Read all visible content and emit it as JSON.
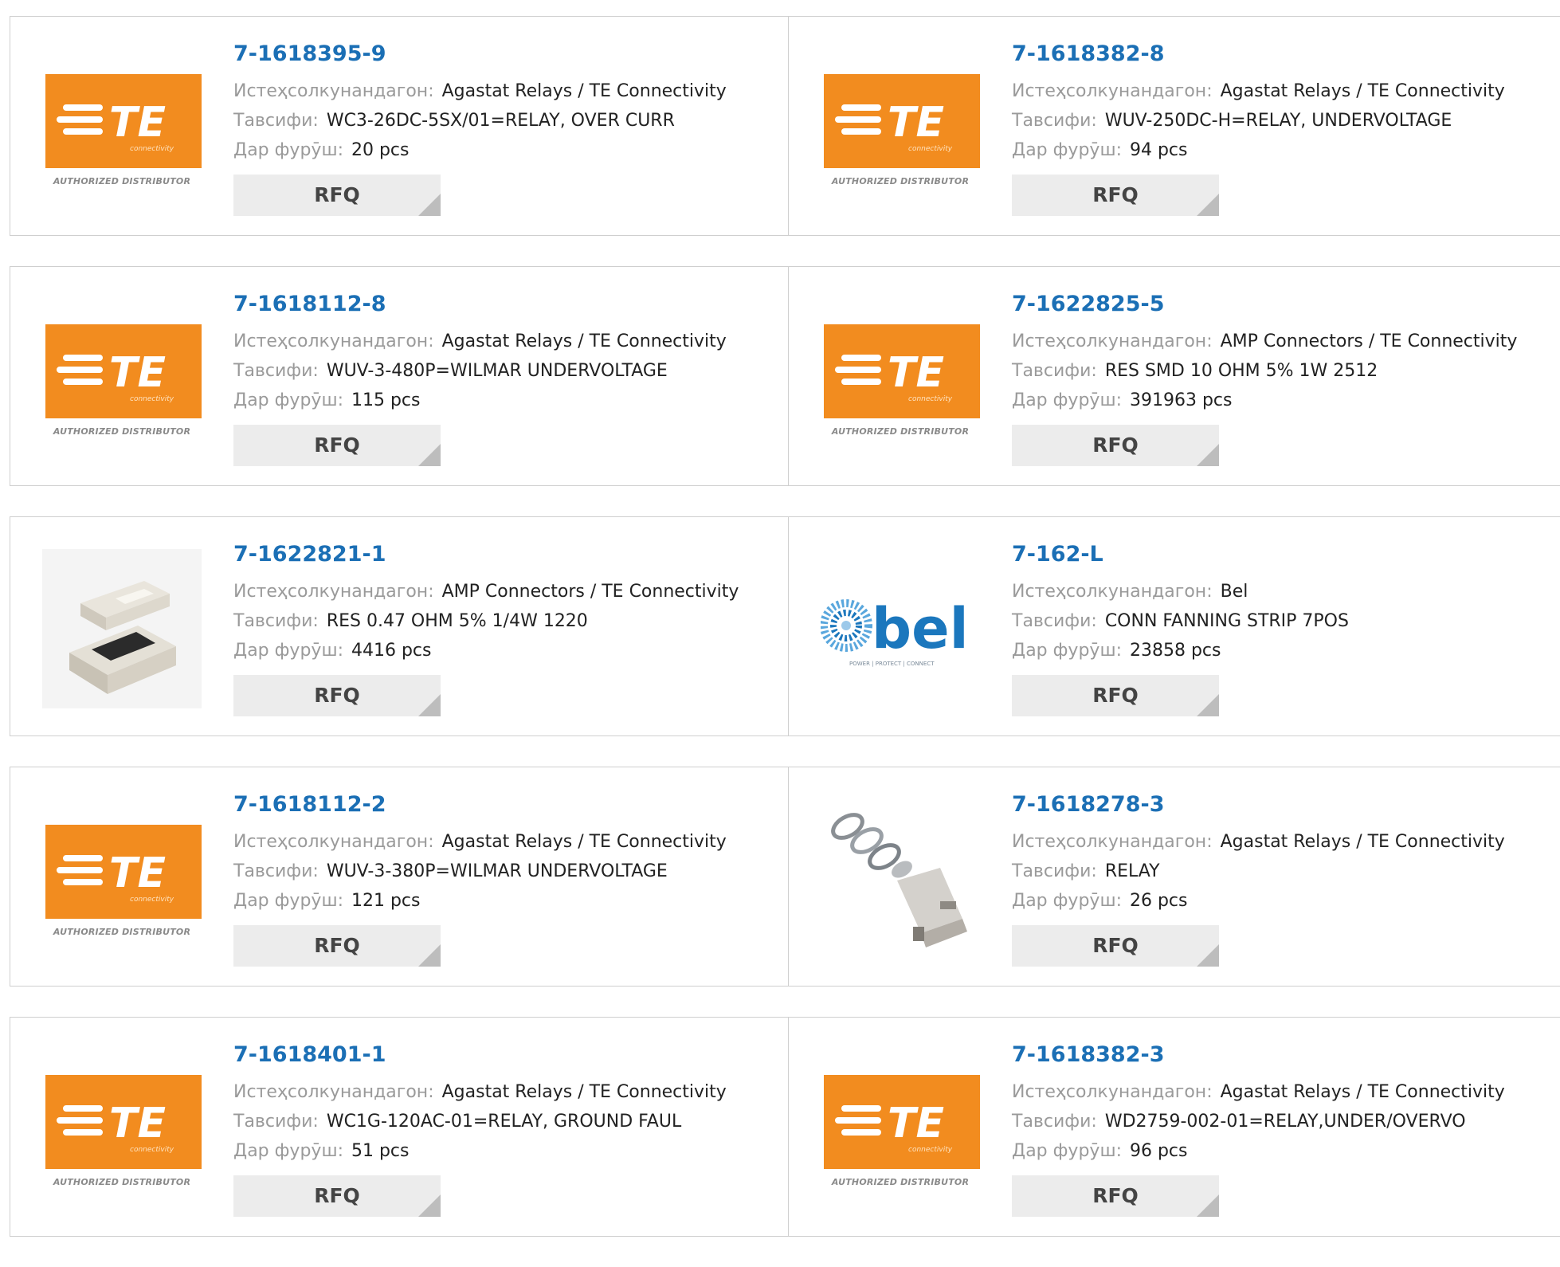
{
  "labels": {
    "manufacturer": "Истеҳсолкунандагон:",
    "description": "Тавсифи:",
    "stock": "Дар фурӯш:"
  },
  "logos": {
    "te_word": "TE",
    "te_sub": "connectivity",
    "te_caption": "AUTHORIZED DISTRIBUTOR",
    "bel_word": "bel",
    "bel_tagline": "POWER | PROTECT | CONNECT"
  },
  "colors": {
    "part_link": "#1b6fb5",
    "te_orange": "#f28c1f",
    "label_gray": "#9a9a9a",
    "rfq_bg": "#ececec",
    "bel_blue": "#1b77bd"
  },
  "products": [
    {
      "part": "7-1618395-9",
      "image": "te-logo",
      "manufacturer": "Agastat Relays / TE Connectivity",
      "description": "WC3-26DC-5SX/01=RELAY, OVER CURR",
      "stock": "20 pcs",
      "rfq": "RFQ"
    },
    {
      "part": "7-1618382-8",
      "image": "te-logo",
      "manufacturer": "Agastat Relays / TE Connectivity",
      "description": "WUV-250DC-H=RELAY, UNDERVOLTAGE",
      "stock": "94 pcs",
      "rfq": "RFQ"
    },
    {
      "part": "7-1618112-8",
      "image": "te-logo",
      "manufacturer": "Agastat Relays / TE Connectivity",
      "description": "WUV-3-480P=WILMAR UNDERVOLTAGE",
      "stock": "115 pcs",
      "rfq": "RFQ"
    },
    {
      "part": "7-1622825-5",
      "image": "te-logo",
      "manufacturer": "AMP Connectors / TE Connectivity",
      "description": "RES SMD 10 OHM 5% 1W 2512",
      "stock": "391963 pcs",
      "rfq": "RFQ"
    },
    {
      "part": "7-1622821-1",
      "image": "smd-resistor",
      "manufacturer": "AMP Connectors / TE Connectivity",
      "description": "RES 0.47 OHM 5% 1/4W 1220",
      "stock": "4416 pcs",
      "rfq": "RFQ"
    },
    {
      "part": "7-162-L",
      "image": "bel-logo",
      "manufacturer": "Bel",
      "description": "CONN FANNING STRIP 7POS",
      "stock": "23858 pcs",
      "rfq": "RFQ"
    },
    {
      "part": "7-1618112-2",
      "image": "te-logo",
      "manufacturer": "Agastat Relays / TE Connectivity",
      "description": "WUV-3-380P=WILMAR UNDERVOLTAGE",
      "stock": "121 pcs",
      "rfq": "RFQ"
    },
    {
      "part": "7-1618278-3",
      "image": "relay-photo",
      "manufacturer": "Agastat Relays / TE Connectivity",
      "description": "RELAY",
      "stock": "26 pcs",
      "rfq": "RFQ"
    },
    {
      "part": "7-1618401-1",
      "image": "te-logo",
      "manufacturer": "Agastat Relays / TE Connectivity",
      "description": "WC1G-120AC-01=RELAY, GROUND FAUL",
      "stock": "51 pcs",
      "rfq": "RFQ"
    },
    {
      "part": "7-1618382-3",
      "image": "te-logo",
      "manufacturer": "Agastat Relays / TE Connectivity",
      "description": "WD2759-002-01=RELAY,UNDER/OVERVO",
      "stock": "96 pcs",
      "rfq": "RFQ"
    }
  ]
}
